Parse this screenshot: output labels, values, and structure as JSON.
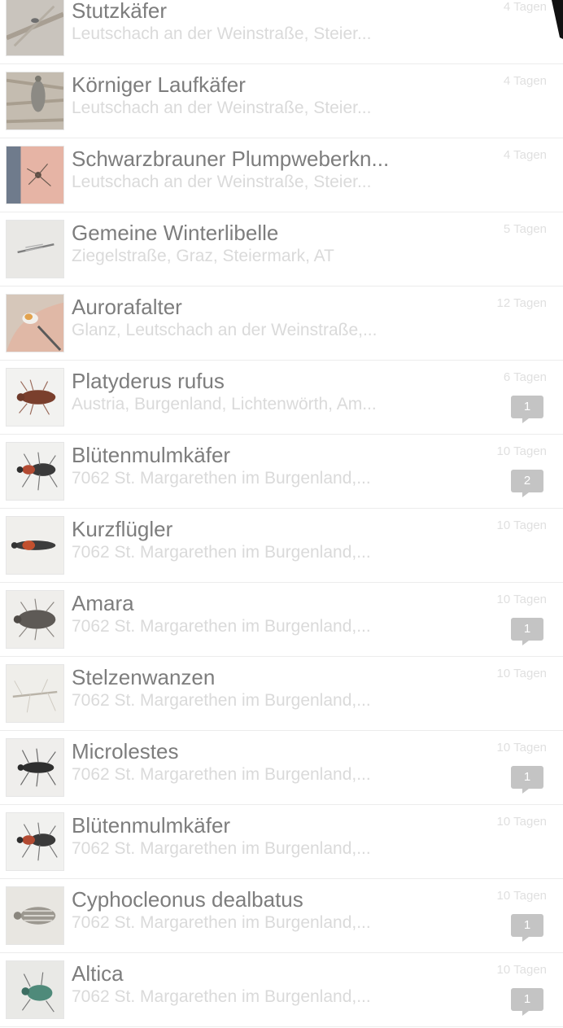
{
  "observations": [
    {
      "title": "Stutzkäfer",
      "subtitle": "Leutschach an der Weinstraße, Steier...",
      "time": "4 Tagen",
      "comments": null,
      "thumb": "stick-beetle"
    },
    {
      "title": "Körniger Laufkäfer",
      "subtitle": "Leutschach an der Weinstraße, Steier...",
      "time": "4 Tagen",
      "comments": null,
      "thumb": "ground-beetle-bark"
    },
    {
      "title": "Schwarzbrauner Plumpweberkn...",
      "subtitle": "Leutschach an der Weinstraße, Steier...",
      "time": "4 Tagen",
      "comments": null,
      "thumb": "harvestman-hand"
    },
    {
      "title": "Gemeine Winterlibelle",
      "subtitle": "Ziegelstraße, Graz, Steiermark, AT",
      "time": "5 Tagen",
      "comments": null,
      "thumb": "damselfly"
    },
    {
      "title": "Aurorafalter",
      "subtitle": "Glanz, Leutschach an der Weinstraße,...",
      "time": "12 Tagen",
      "comments": null,
      "thumb": "butterfly-hand"
    },
    {
      "title": "Platyderus rufus",
      "subtitle": "Austria, Burgenland, Lichtenwörth, Am...",
      "time": "6 Tagen",
      "comments": "1",
      "thumb": "red-beetle"
    },
    {
      "title": "Blütenmulmkäfer",
      "subtitle": "7062 St. Margarethen im Burgenland,...",
      "time": "10 Tagen",
      "comments": "2",
      "thumb": "red-black-beetle"
    },
    {
      "title": "Kurzflügler",
      "subtitle": "7062 St. Margarethen im Burgenland,...",
      "time": "10 Tagen",
      "comments": null,
      "thumb": "rove-beetle"
    },
    {
      "title": "Amara",
      "subtitle": "7062 St. Margarethen im Burgenland,...",
      "time": "10 Tagen",
      "comments": "1",
      "thumb": "dark-beetle"
    },
    {
      "title": "Stelzenwanzen",
      "subtitle": "7062 St. Margarethen im Burgenland,...",
      "time": "10 Tagen",
      "comments": null,
      "thumb": "stilt-bug"
    },
    {
      "title": "Microlestes",
      "subtitle": "7062 St. Margarethen im Burgenland,...",
      "time": "10 Tagen",
      "comments": "1",
      "thumb": "small-black-beetle"
    },
    {
      "title": "Blütenmulmkäfer",
      "subtitle": "7062 St. Margarethen im Burgenland,...",
      "time": "10 Tagen",
      "comments": null,
      "thumb": "red-black-beetle"
    },
    {
      "title": "Cyphocleonus dealbatus",
      "subtitle": "7062 St. Margarethen im Burgenland,...",
      "time": "10 Tagen",
      "comments": "1",
      "thumb": "weevil"
    },
    {
      "title": "Altica",
      "subtitle": "7062 St. Margarethen im Burgenland,...",
      "time": "10 Tagen",
      "comments": "1",
      "thumb": "metallic-beetle"
    }
  ],
  "colors": {
    "title": "#7d7d7d",
    "subtitle": "#dadada",
    "time": "#e0e0e0",
    "badge": "#c4c4c4",
    "divider": "#ececec"
  }
}
